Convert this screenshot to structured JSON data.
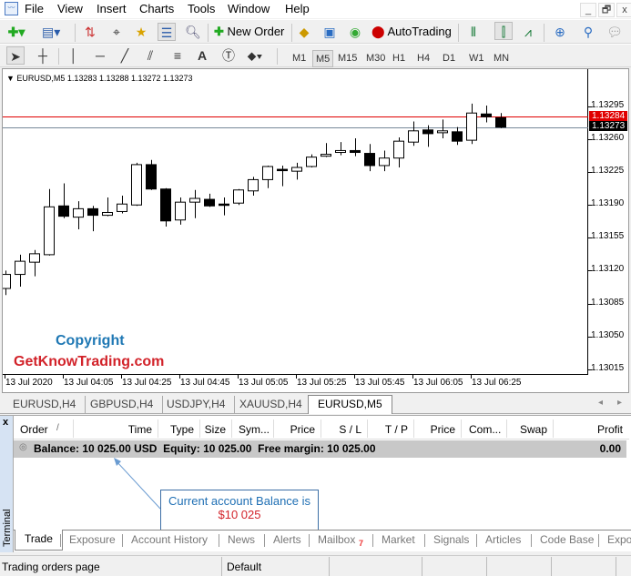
{
  "menu": {
    "items": [
      "File",
      "View",
      "Insert",
      "Charts",
      "Tools",
      "Window",
      "Help"
    ]
  },
  "window_controls": {
    "minimize": "_",
    "restore": "🗗",
    "close": "x"
  },
  "toolbar": {
    "new_order_label": "New Order",
    "autotrading_label": "AutoTrading"
  },
  "timeframes": [
    "M1",
    "M5",
    "M15",
    "M30",
    "H1",
    "H4",
    "D1",
    "W1",
    "MN"
  ],
  "active_timeframe": "M5",
  "chart": {
    "header": "EURUSD,M5  1.13283 1.13288 1.13272 1.13273",
    "ask_label": "1.13284",
    "bid_label": "1.13273",
    "watermark_line1": "Copyright",
    "watermark_line2": "GetKnowTrading.com",
    "colors": {
      "ask_line": "#e00000",
      "bid_line": "#778899",
      "bull_body": "#ffffff",
      "bear_body": "#000000"
    }
  },
  "chart_data": {
    "type": "candlestick",
    "symbol": "EURUSD",
    "timeframe": "M5",
    "price_ticks": [
      "1.13295",
      "1.13260",
      "1.13225",
      "1.13190",
      "1.13155",
      "1.13120",
      "1.13085",
      "1.13050",
      "1.13015"
    ],
    "time_labels": [
      "13 Jul 2020",
      "13 Jul 04:05",
      "13 Jul 04:25",
      "13 Jul 04:45",
      "13 Jul 05:05",
      "13 Jul 05:25",
      "13 Jul 05:45",
      "13 Jul 06:05",
      "13 Jul 06:25"
    ],
    "ylim": [
      1.13,
      1.13318
    ],
    "candles_ohlc": [
      [
        1.13101,
        1.1312,
        1.13094,
        1.13116
      ],
      [
        1.13116,
        1.13137,
        1.13103,
        1.1313
      ],
      [
        1.13129,
        1.13142,
        1.13114,
        1.13138
      ],
      [
        1.13137,
        1.13207,
        1.13136,
        1.13188
      ],
      [
        1.13189,
        1.13213,
        1.13176,
        1.13178
      ],
      [
        1.13177,
        1.13194,
        1.13164,
        1.13186
      ],
      [
        1.13186,
        1.13189,
        1.13162,
        1.13179
      ],
      [
        1.13179,
        1.13198,
        1.13178,
        1.13182
      ],
      [
        1.13183,
        1.132,
        1.13181,
        1.13191
      ],
      [
        1.1319,
        1.13235,
        1.13189,
        1.13233
      ],
      [
        1.13233,
        1.13238,
        1.13206,
        1.13207
      ],
      [
        1.13207,
        1.13208,
        1.13167,
        1.13173
      ],
      [
        1.13174,
        1.13198,
        1.13169,
        1.13193
      ],
      [
        1.13193,
        1.13206,
        1.13176,
        1.13197
      ],
      [
        1.13196,
        1.13202,
        1.13188,
        1.13189
      ],
      [
        1.13191,
        1.13198,
        1.13179,
        1.1319
      ],
      [
        1.13192,
        1.13207,
        1.1319,
        1.13206
      ],
      [
        1.13205,
        1.1322,
        1.132,
        1.13217
      ],
      [
        1.13217,
        1.13232,
        1.13208,
        1.13231
      ],
      [
        1.13228,
        1.13232,
        1.1321,
        1.13227
      ],
      [
        1.13226,
        1.13235,
        1.13217,
        1.1323
      ],
      [
        1.13231,
        1.13244,
        1.1323,
        1.13241
      ],
      [
        1.13242,
        1.13256,
        1.13241,
        1.13244
      ],
      [
        1.13246,
        1.13257,
        1.13243,
        1.13248
      ],
      [
        1.13248,
        1.13261,
        1.13242,
        1.13246
      ],
      [
        1.13245,
        1.13255,
        1.13226,
        1.13232
      ],
      [
        1.13232,
        1.13248,
        1.13226,
        1.1324
      ],
      [
        1.1324,
        1.13262,
        1.1323,
        1.13258
      ],
      [
        1.13257,
        1.13279,
        1.13253,
        1.13269
      ],
      [
        1.1327,
        1.13275,
        1.13252,
        1.13266
      ],
      [
        1.13267,
        1.13281,
        1.13261,
        1.13269
      ],
      [
        1.13268,
        1.13273,
        1.13254,
        1.13258
      ],
      [
        1.13259,
        1.13298,
        1.13255,
        1.13288
      ],
      [
        1.13287,
        1.13296,
        1.13278,
        1.13284
      ],
      [
        1.13283,
        1.13288,
        1.13272,
        1.13273
      ]
    ],
    "ask": 1.13284,
    "bid": 1.13273,
    "grid": false
  },
  "chart_tabs": [
    {
      "label": "EURUSD,H4",
      "active": false
    },
    {
      "label": "GBPUSD,H4",
      "active": false
    },
    {
      "label": "USDJPY,H4",
      "active": false
    },
    {
      "label": "XAUUSD,H4",
      "active": false
    },
    {
      "label": "EURUSD,M5",
      "active": true
    }
  ],
  "terminal": {
    "side_label": "Terminal",
    "close": "x",
    "columns": [
      "Order",
      "Time",
      "Type",
      "Size",
      "Sym...",
      "Price",
      "S / L",
      "T / P",
      "Price",
      "Com...",
      "Swap",
      "Profit"
    ],
    "sort_indicator": "/",
    "balance_row": {
      "text": "Balance: 10 025.00 USD  Equity: 10 025.00  Free margin: 10 025.00",
      "profit": "0.00"
    },
    "annotation": {
      "line1": "Current account Balance is",
      "line2": "$10 025"
    },
    "tabs": [
      "Trade",
      "Exposure",
      "Account History",
      "News",
      "Alerts",
      "Mailbox",
      "Market",
      "Signals",
      "Articles",
      "Code Base",
      "Expo"
    ],
    "active_tab": "Trade",
    "mailbox_badge": "7"
  },
  "status": {
    "left": "Trading orders page",
    "profile": "Default"
  }
}
